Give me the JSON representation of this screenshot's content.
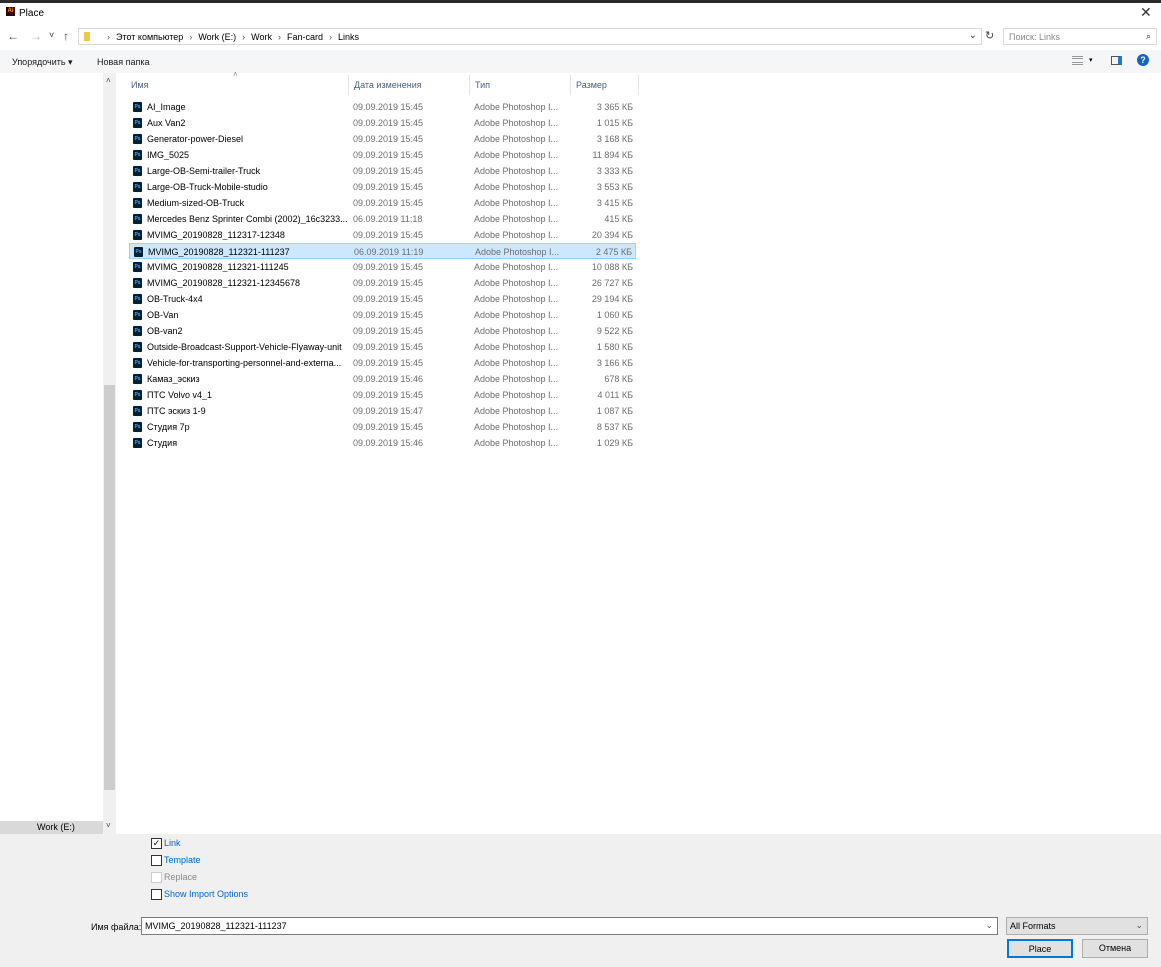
{
  "window": {
    "title": "Place",
    "close": "✕"
  },
  "nav": {
    "back": "←",
    "forward": "→",
    "recent": "˅",
    "up": "↑",
    "breadcrumb": [
      "Этот компьютер",
      "Work (E:)",
      "Work",
      "Fan-card",
      "Links"
    ],
    "search_placeholder": "Поиск: Links"
  },
  "toolbar": {
    "organize": "Упорядочить ▾",
    "new_folder": "Новая папка"
  },
  "sidebar": {
    "drive": "Work (E:)"
  },
  "columns": {
    "name": "Имя",
    "date": "Дата изменения",
    "type": "Тип",
    "size": "Размер"
  },
  "files": [
    {
      "name": "AI_Image",
      "date": "09.09.2019 15:45",
      "type": "Adobe Photoshop I...",
      "size": "3 365 КБ"
    },
    {
      "name": "Aux Van2",
      "date": "09.09.2019 15:45",
      "type": "Adobe Photoshop I...",
      "size": "1 015 КБ"
    },
    {
      "name": "Generator-power-Diesel",
      "date": "09.09.2019 15:45",
      "type": "Adobe Photoshop I...",
      "size": "3 168 КБ"
    },
    {
      "name": "IMG_5025",
      "date": "09.09.2019 15:45",
      "type": "Adobe Photoshop I...",
      "size": "11 894 КБ"
    },
    {
      "name": "Large-OB-Semi-trailer-Truck",
      "date": "09.09.2019 15:45",
      "type": "Adobe Photoshop I...",
      "size": "3 333 КБ"
    },
    {
      "name": "Large-OB-Truck-Mobile-studio",
      "date": "09.09.2019 15:45",
      "type": "Adobe Photoshop I...",
      "size": "3 553 КБ"
    },
    {
      "name": "Medium-sized-OB-Truck",
      "date": "09.09.2019 15:45",
      "type": "Adobe Photoshop I...",
      "size": "3 415 КБ"
    },
    {
      "name": "Mercedes Benz Sprinter Combi (2002)_16c3233...",
      "date": "06.09.2019 11:18",
      "type": "Adobe Photoshop I...",
      "size": "415 КБ"
    },
    {
      "name": "MVIMG_20190828_112317-12348",
      "date": "09.09.2019 15:45",
      "type": "Adobe Photoshop I...",
      "size": "20 394 КБ"
    },
    {
      "name": "MVIMG_20190828_112321-111237",
      "date": "06.09.2019 11:19",
      "type": "Adobe Photoshop I...",
      "size": "2 475 КБ"
    },
    {
      "name": "MVIMG_20190828_112321-111245",
      "date": "09.09.2019 15:45",
      "type": "Adobe Photoshop I...",
      "size": "10 088 КБ"
    },
    {
      "name": "MVIMG_20190828_112321-12345678",
      "date": "09.09.2019 15:45",
      "type": "Adobe Photoshop I...",
      "size": "26 727 КБ"
    },
    {
      "name": "OB-Truck-4x4",
      "date": "09.09.2019 15:45",
      "type": "Adobe Photoshop I...",
      "size": "29 194 КБ"
    },
    {
      "name": "OB-Van",
      "date": "09.09.2019 15:45",
      "type": "Adobe Photoshop I...",
      "size": "1 060 КБ"
    },
    {
      "name": "OB-van2",
      "date": "09.09.2019 15:45",
      "type": "Adobe Photoshop I...",
      "size": "9 522 КБ"
    },
    {
      "name": "Outside-Broadcast-Support-Vehicle-Flyaway-unit",
      "date": "09.09.2019 15:45",
      "type": "Adobe Photoshop I...",
      "size": "1 580 КБ"
    },
    {
      "name": "Vehicle-for-transporting-personnel-and-externa...",
      "date": "09.09.2019 15:45",
      "type": "Adobe Photoshop I...",
      "size": "3 166 КБ"
    },
    {
      "name": "Камаз_эскиз",
      "date": "09.09.2019 15:46",
      "type": "Adobe Photoshop I...",
      "size": "678 КБ"
    },
    {
      "name": "ПТС Volvo v4_1",
      "date": "09.09.2019 15:45",
      "type": "Adobe Photoshop I...",
      "size": "4 011 КБ"
    },
    {
      "name": "ПТС эскиз 1-9",
      "date": "09.09.2019 15:47",
      "type": "Adobe Photoshop I...",
      "size": "1 087 КБ"
    },
    {
      "name": "Студия 7р",
      "date": "09.09.2019 15:45",
      "type": "Adobe Photoshop I...",
      "size": "8 537 КБ"
    },
    {
      "name": "Студия",
      "date": "09.09.2019 15:46",
      "type": "Adobe Photoshop I...",
      "size": "1 029 КБ"
    }
  ],
  "selected_index": 9,
  "options": [
    {
      "label": "Link",
      "checked": true,
      "disabled": false
    },
    {
      "label": "Template",
      "checked": false,
      "disabled": false
    },
    {
      "label": "Replace",
      "checked": false,
      "disabled": true
    },
    {
      "label": "Show Import Options",
      "checked": false,
      "disabled": false
    }
  ],
  "filename": {
    "label": "Имя файла:",
    "value": "MVIMG_20190828_112321-111237"
  },
  "format": "All Formats",
  "buttons": {
    "place": "Place",
    "cancel": "Отмена"
  },
  "icons": {
    "ps_glyph": "Ps",
    "ai_glyph": "Ai"
  }
}
